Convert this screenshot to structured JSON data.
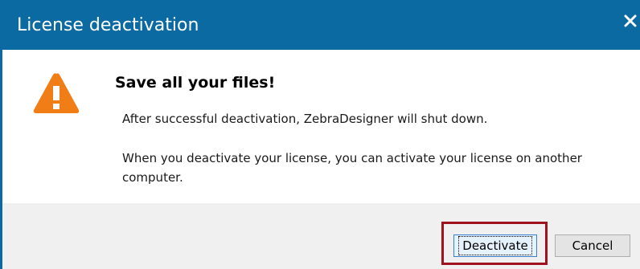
{
  "dialog": {
    "title": "License deactivation",
    "close_icon": "close-icon",
    "warning_icon": "warning-icon",
    "headline": "Save all your files!",
    "message_1": "After successful deactivation, ZebraDesigner will shut down.",
    "message_2": "When you deactivate your license, you can activate your license on another computer.",
    "buttons": {
      "deactivate_label": "Deactivate",
      "cancel_label": "Cancel"
    },
    "colors": {
      "titlebar": "#0b6aa2",
      "warning": "#f07d16",
      "highlight": "#a0121e"
    }
  }
}
